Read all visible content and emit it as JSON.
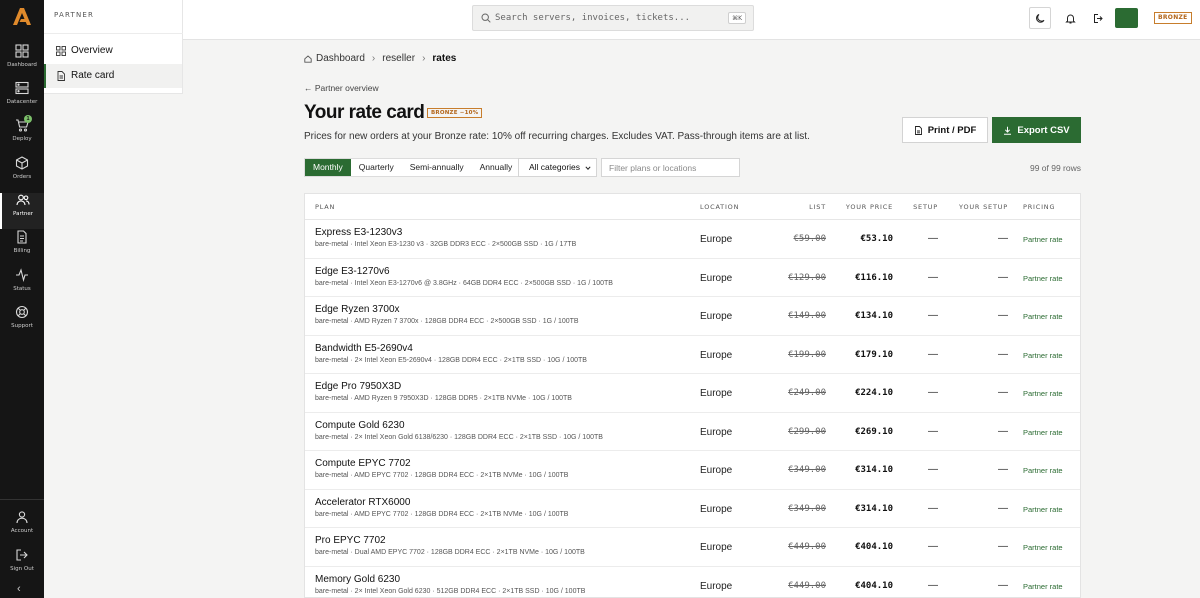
{
  "rail": {
    "items": [
      {
        "label": "Dashboard",
        "icon": "dashboard-icon"
      },
      {
        "label": "Datacenter",
        "icon": "server-icon"
      },
      {
        "label": "Deploy",
        "icon": "cart-icon",
        "badge": "1"
      },
      {
        "label": "Orders",
        "icon": "box-icon"
      },
      {
        "label": "Partner",
        "icon": "users-icon",
        "active": true
      },
      {
        "label": "Billing",
        "icon": "file-icon"
      },
      {
        "label": "Status",
        "icon": "activity-icon"
      },
      {
        "label": "Support",
        "icon": "lifebuoy-icon"
      }
    ],
    "bottom": [
      {
        "label": "Account",
        "icon": "user-icon"
      },
      {
        "label": "Sign Out",
        "icon": "logout-icon"
      }
    ]
  },
  "subnav": {
    "section": "PARTNER",
    "items": [
      {
        "label": "Overview"
      },
      {
        "label": "Rate card",
        "active": true
      }
    ]
  },
  "topbar": {
    "search_placeholder": "Search servers, invoices, tickets...",
    "shortcut": "⌘K",
    "tier": "BRONZE"
  },
  "breadcrumb": {
    "home": "Dashboard",
    "mid": "reseller",
    "current": "rates"
  },
  "page": {
    "back_link": "← Partner overview",
    "title": "Your rate card",
    "tier_tag": "BRONZE −10%",
    "subtitle": "Prices for new orders at your Bronze rate: 10% off recurring charges. Excludes VAT. Pass-through items are at list.",
    "print_label": "Print / PDF",
    "export_label": "Export CSV",
    "periods": [
      "Monthly",
      "Quarterly",
      "Semi-annually",
      "Annually"
    ],
    "category_select": "All categories",
    "filter_placeholder": "Filter plans or locations",
    "row_count": "99 of 99 rows"
  },
  "table": {
    "headers": {
      "plan": "PLAN",
      "location": "LOCATION",
      "list": "LIST",
      "your_price": "YOUR PRICE",
      "setup": "SETUP",
      "your_setup": "YOUR SETUP",
      "pricing": "PRICING"
    },
    "rows": [
      {
        "name": "Express E3-1230v3",
        "specs": "bare-metal · Intel Xeon E3-1230 v3 · 32GB DDR3 ECC · 2×500GB SSD · 1G / 17TB",
        "location": "Europe",
        "list": "€59.00",
        "price": "€53.10",
        "setup": "—",
        "your_setup": "—",
        "pricing": "Partner rate"
      },
      {
        "name": "Edge E3-1270v6",
        "specs": "bare-metal · Intel Xeon E3-1270v6 @ 3.8GHz · 64GB DDR4 ECC · 2×500GB SSD · 1G / 100TB",
        "location": "Europe",
        "list": "€129.00",
        "price": "€116.10",
        "setup": "—",
        "your_setup": "—",
        "pricing": "Partner rate"
      },
      {
        "name": "Edge Ryzen 3700x",
        "specs": "bare-metal · AMD Ryzen 7 3700x · 128GB DDR4 ECC · 2×500GB SSD · 1G / 100TB",
        "location": "Europe",
        "list": "€149.00",
        "price": "€134.10",
        "setup": "—",
        "your_setup": "—",
        "pricing": "Partner rate"
      },
      {
        "name": "Bandwidth E5-2690v4",
        "specs": "bare-metal · 2× Intel Xeon E5-2690v4 · 128GB DDR4 ECC · 2×1TB SSD · 10G / 100TB",
        "location": "Europe",
        "list": "€199.00",
        "price": "€179.10",
        "setup": "—",
        "your_setup": "—",
        "pricing": "Partner rate"
      },
      {
        "name": "Edge Pro 7950X3D",
        "specs": "bare-metal · AMD Ryzen 9 7950X3D · 128GB DDR5 · 2×1TB NVMe · 10G / 100TB",
        "location": "Europe",
        "list": "€249.00",
        "price": "€224.10",
        "setup": "—",
        "your_setup": "—",
        "pricing": "Partner rate"
      },
      {
        "name": "Compute Gold 6230",
        "specs": "bare-metal · 2× Intel Xeon Gold 6138/6230 · 128GB DDR4 ECC · 2×1TB SSD · 10G / 100TB",
        "location": "Europe",
        "list": "€299.00",
        "price": "€269.10",
        "setup": "—",
        "your_setup": "—",
        "pricing": "Partner rate"
      },
      {
        "name": "Compute EPYC 7702",
        "specs": "bare-metal · AMD EPYC 7702 · 128GB DDR4 ECC · 2×1TB NVMe · 10G / 100TB",
        "location": "Europe",
        "list": "€349.00",
        "price": "€314.10",
        "setup": "—",
        "your_setup": "—",
        "pricing": "Partner rate"
      },
      {
        "name": "Accelerator RTX6000",
        "specs": "bare-metal · AMD EPYC 7702 · 128GB DDR4 ECC · 2×1TB NVMe · 10G / 100TB",
        "location": "Europe",
        "list": "€349.00",
        "price": "€314.10",
        "setup": "—",
        "your_setup": "—",
        "pricing": "Partner rate"
      },
      {
        "name": "Pro EPYC 7702",
        "specs": "bare-metal · Dual AMD EPYC 7702 · 128GB DDR4 ECC · 2×1TB NVMe · 10G / 100TB",
        "location": "Europe",
        "list": "€449.00",
        "price": "€404.10",
        "setup": "—",
        "your_setup": "—",
        "pricing": "Partner rate"
      },
      {
        "name": "Memory Gold 6230",
        "specs": "bare-metal · 2× Intel Xeon Gold 6230 · 512GB DDR4 ECC · 2×1TB SSD · 10G / 100TB",
        "location": "Europe",
        "list": "€449.00",
        "price": "€404.10",
        "setup": "—",
        "your_setup": "—",
        "pricing": "Partner rate"
      }
    ]
  },
  "colors": {
    "accent": "#2b6b32",
    "rail_bg": "#151515",
    "tier": "#c77d2c"
  }
}
